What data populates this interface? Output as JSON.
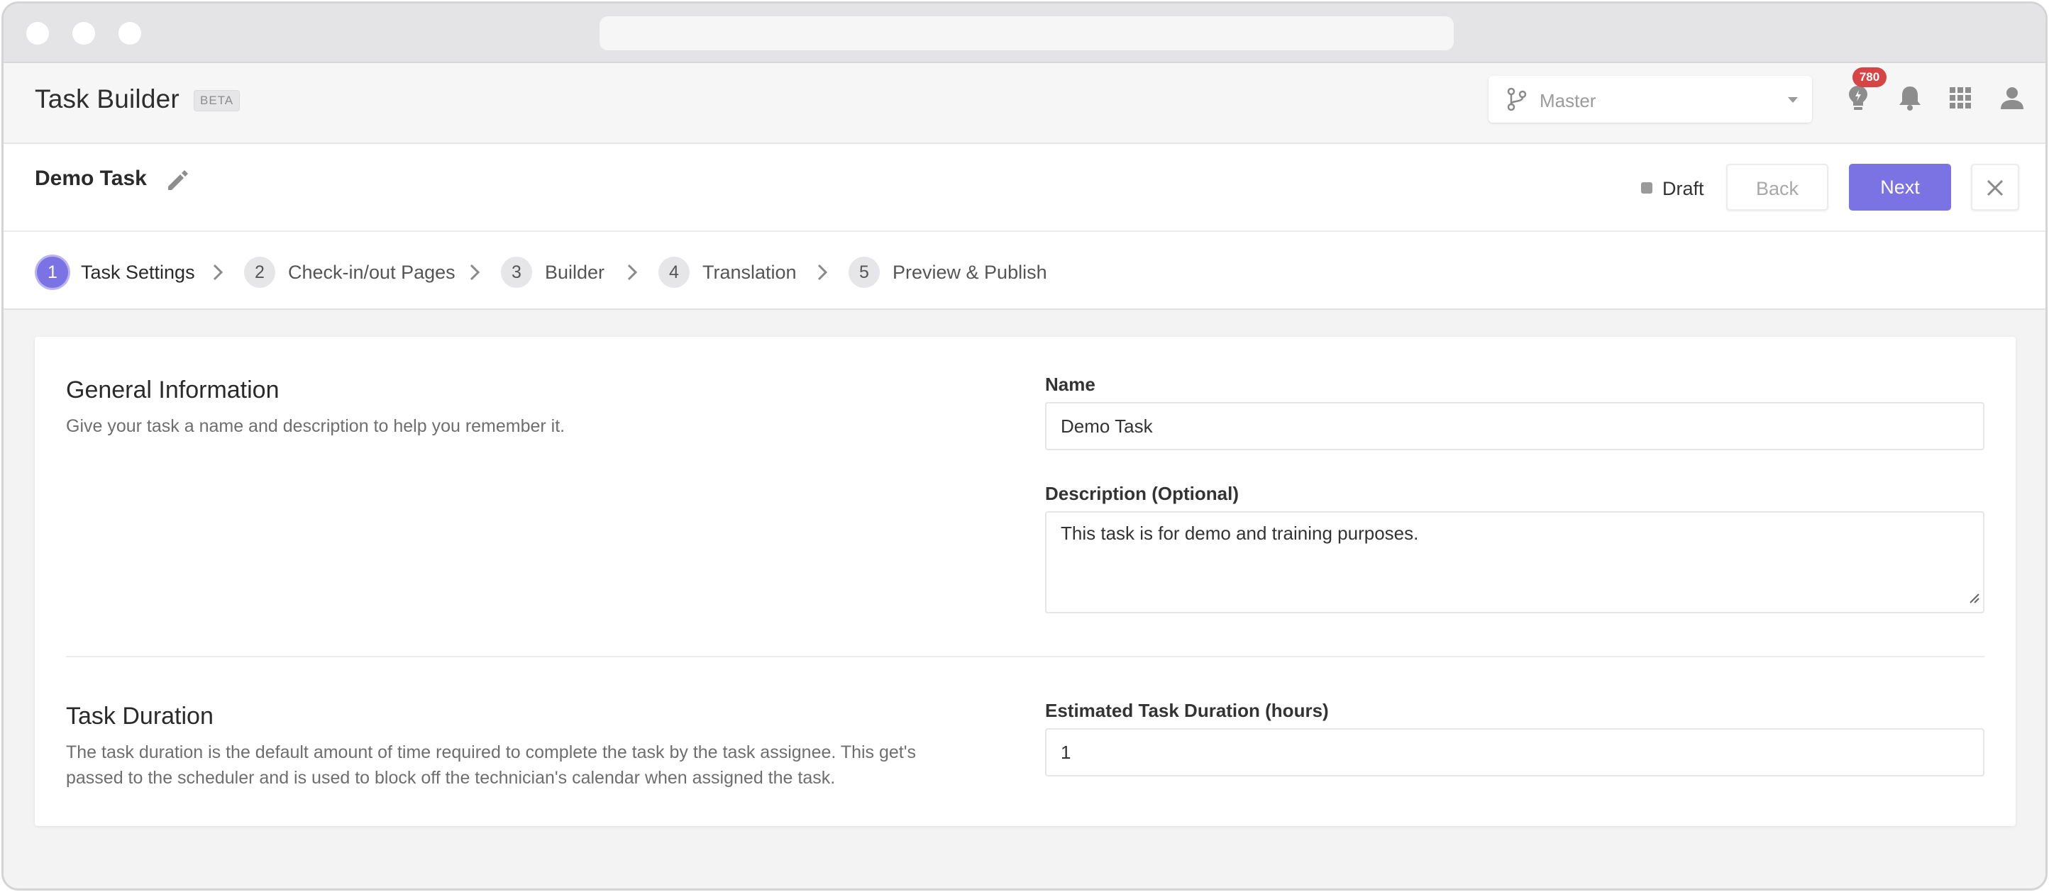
{
  "app": {
    "title": "Task Builder",
    "badge": "BETA",
    "branch": "Master",
    "notification_count": "780",
    "icons": [
      "lightbulb-icon",
      "bell-icon",
      "apps-grid-icon",
      "user-icon"
    ]
  },
  "task": {
    "name": "Demo Task",
    "status": "Draft",
    "back_label": "Back",
    "next_label": "Next"
  },
  "steps": [
    {
      "num": "1",
      "label": "Task Settings",
      "active": true
    },
    {
      "num": "2",
      "label": "Check-in/out Pages",
      "active": false
    },
    {
      "num": "3",
      "label": "Builder",
      "active": false
    },
    {
      "num": "4",
      "label": "Translation",
      "active": false
    },
    {
      "num": "5",
      "label": "Preview & Publish",
      "active": false
    }
  ],
  "general": {
    "title": "General Information",
    "description": "Give your task a name and description to help you remember it.",
    "name_label": "Name",
    "name_value": "Demo Task",
    "description_label": "Description (Optional)",
    "description_value": "This task is for demo and training purposes."
  },
  "duration": {
    "title": "Task Duration",
    "description_line1": "The task duration is the default amount of time required to complete the task by the task assignee. This get's",
    "description_line2": "passed to the scheduler and is used to block off the technician's calendar when assigned the task.",
    "label": "Estimated Task Duration (hours)",
    "value": "1"
  },
  "colors": {
    "accent": "#7b72e3",
    "badge": "#d64545"
  }
}
